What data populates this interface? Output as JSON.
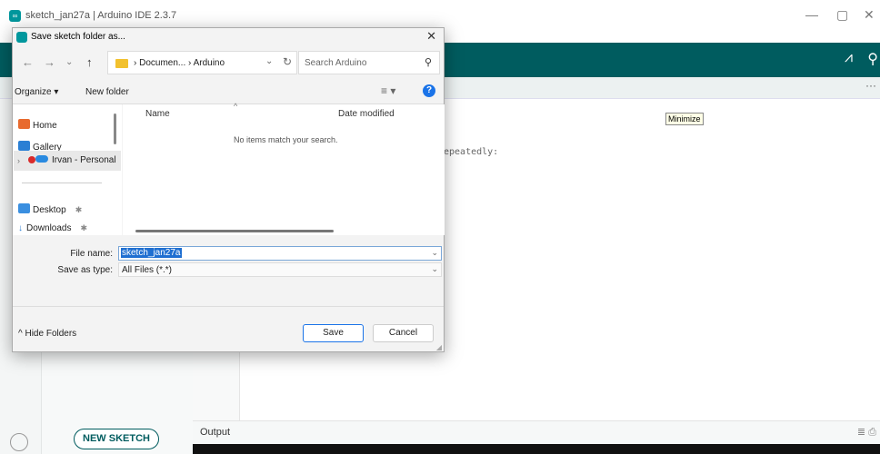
{
  "ide": {
    "window_title": "sketch_jan27a | Arduino IDE 2.3.7",
    "code_line": "epeatedly:",
    "tooltip": "Minimize",
    "new_sketch": "NEW SKETCH",
    "output_tab": "Output",
    "more": "···"
  },
  "dialog": {
    "title": "Save sketch folder as...",
    "address_path": "›  Documen...  ›  Arduino",
    "search_placeholder": "Search Arduino",
    "organize": "Organize ▾",
    "new_folder": "New folder",
    "nav": {
      "home": "Home",
      "gallery": "Gallery",
      "onedrive": "Irvan - Personal",
      "desktop": "Desktop",
      "downloads": "Downloads"
    },
    "columns": {
      "name": "Name",
      "date": "Date modified"
    },
    "empty_message": "No items match your search.",
    "file_name_label": "File name:",
    "file_name_value": "sketch_jan27a",
    "save_type_label": "Save as type:",
    "save_type_value": "All Files (*.*)",
    "hide_folders": "Hide Folders",
    "save": "Save",
    "cancel": "Cancel"
  },
  "colors": {
    "toolbar": "#005c5f",
    "accent": "#1a73e8",
    "selection": "#1f6fd1"
  }
}
